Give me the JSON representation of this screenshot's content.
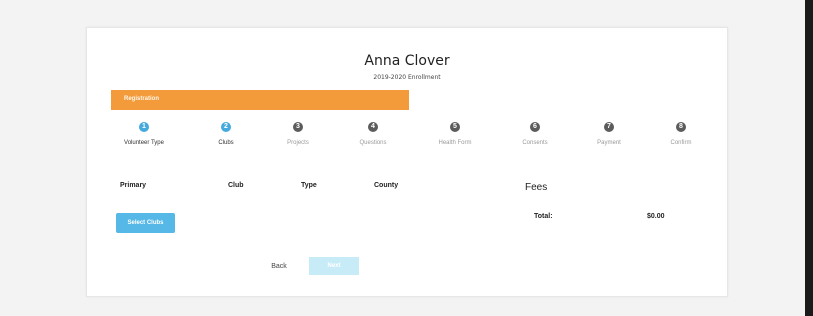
{
  "enrollment": {
    "member_name": "Anna Clover",
    "subtitle": "2019-2020 Enrollment",
    "progress_label": "Registration"
  },
  "steps": [
    {
      "number": "1",
      "label": "Volunteer Type",
      "state": "active"
    },
    {
      "number": "2",
      "label": "Clubs",
      "state": "active"
    },
    {
      "number": "3",
      "label": "Projects",
      "state": "inactive"
    },
    {
      "number": "4",
      "label": "Questions",
      "state": "inactive"
    },
    {
      "number": "5",
      "label": "Health Form",
      "state": "inactive"
    },
    {
      "number": "6",
      "label": "Consents",
      "state": "inactive"
    },
    {
      "number": "7",
      "label": "Payment",
      "state": "inactive"
    },
    {
      "number": "8",
      "label": "Confirm",
      "state": "inactive"
    }
  ],
  "clubs_table": {
    "columns": [
      "Primary",
      "Club",
      "Type",
      "County"
    ],
    "select_button": "Select Clubs"
  },
  "fees": {
    "heading": "Fees",
    "total_label": "Total:",
    "total_value": "$0.00"
  },
  "navigation": {
    "back_label": "Back",
    "next_label": "Next"
  },
  "colors": {
    "progress": "#f39a3a",
    "active_step": "#44a9dd",
    "inactive_step": "#5c5c5c",
    "select_button": "#56b8e6",
    "next_button_disabled": "#c7ecf8"
  }
}
